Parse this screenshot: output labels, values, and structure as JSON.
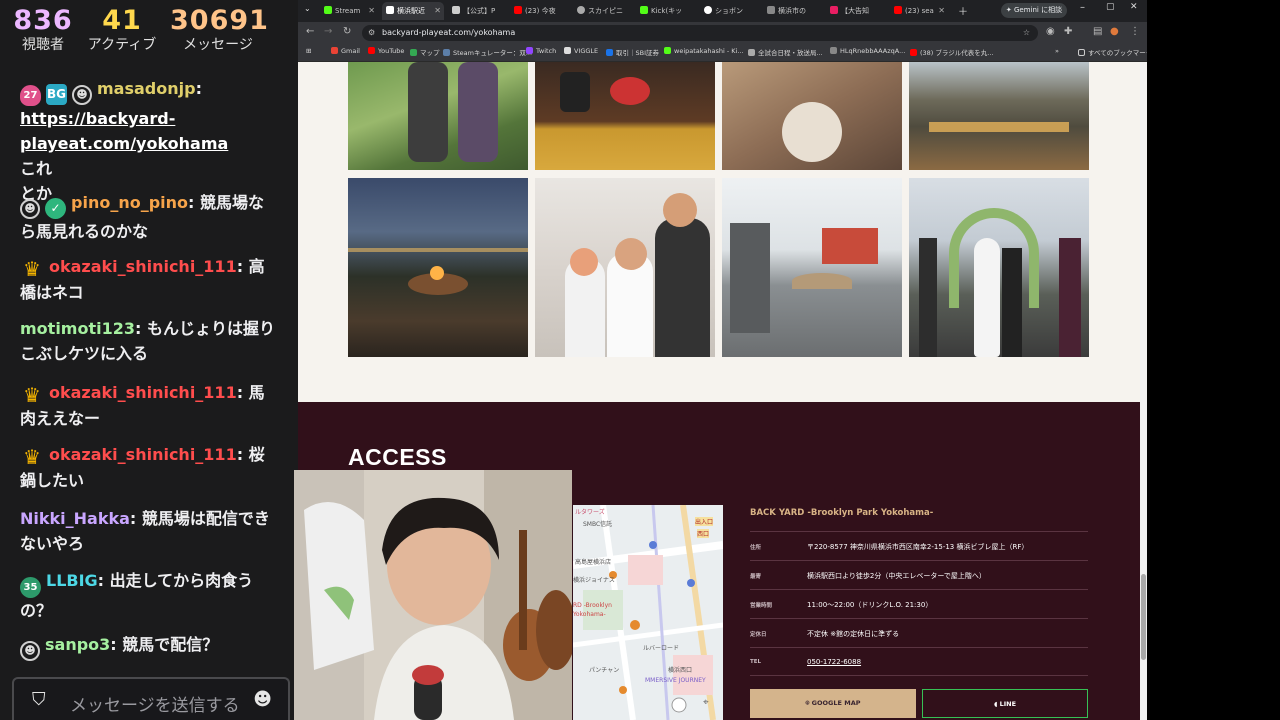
{
  "stats": {
    "viewers": {
      "value": "836",
      "label": "視聴者"
    },
    "active": {
      "value": "41",
      "label": "アクティブ"
    },
    "messages": {
      "value": "30691",
      "label": "メッセージ"
    }
  },
  "chat": [
    {
      "user": "masadonjp",
      "color": "#e0cf6a",
      "badges": [
        "pink-27",
        "bg",
        "dark"
      ],
      "lines": [
        "https://backyard-",
        "playeat.com/yokohama"
      ],
      "tail": "これ",
      "extra": "とか"
    },
    {
      "user": "pino_no_pino",
      "color": "#f7a44a",
      "badges": [
        "dark",
        "verified"
      ],
      "text": "競馬場なら馬見れるのかな"
    },
    {
      "user": "okazaki_shinichi_111",
      "color": "#ff4d4d",
      "badges": [
        "crown"
      ],
      "text": "高橋はネコ"
    },
    {
      "user": "motimoti123",
      "color": "#a6f0a0",
      "badges": [],
      "text": "もんじょりは握りこぶしケツに入る"
    },
    {
      "user": "okazaki_shinichi_111",
      "color": "#ff4d4d",
      "badges": [
        "crown"
      ],
      "text": "馬肉ええなー"
    },
    {
      "user": "okazaki_shinichi_111",
      "color": "#ff4d4d",
      "badges": [
        "crown"
      ],
      "text": "桜鍋したい"
    },
    {
      "user": "Nikki_Hakka",
      "color": "#c9a6ff",
      "badges": [],
      "text": "競馬場は配信できないやろ"
    },
    {
      "user": "LLBIG",
      "color": "#4dd8e6",
      "badges": [
        "teal-35"
      ],
      "text": "出走してから肉食うの？"
    },
    {
      "user": "sanpo3",
      "color": "#a6f0a0",
      "badges": [
        "dark"
      ],
      "text": "競馬で配信？"
    }
  ],
  "chat_input": {
    "placeholder": "メッセージを送信する"
  },
  "browser": {
    "tabs": [
      {
        "label": "Stream",
        "color": "#53fc18"
      },
      {
        "label": "横浜駅近",
        "color": "#fff",
        "active": true
      },
      {
        "label": "【公式】P",
        "color": "#ccc"
      },
      {
        "label": "(23) 今夜",
        "color": "#ff0000"
      },
      {
        "label": "スカイピニ",
        "color": "#aaa"
      },
      {
        "label": "Kick(キッ",
        "color": "#53fc18"
      },
      {
        "label": "ショボン",
        "color": "#fff"
      },
      {
        "label": "横浜市の",
        "color": "#888"
      },
      {
        "label": "【大告知",
        "color": "#e91e63"
      },
      {
        "label": "(23) sea",
        "color": "#ff0000"
      }
    ],
    "gemini": "Gemini に相談",
    "url": "backyard-playeat.com/yokohama",
    "bookmarks": [
      "Gmail",
      "YouTube",
      "マップ",
      "Steamキュレーター：双...",
      "Twitch",
      "VIGGLE",
      "取引｜SBI証券",
      "weipatakahashi - Ki...",
      "全試合日程・放送局...",
      "HLqRnebbAAAzqA...",
      "(38) ブラジル代表を丸...",
      "すべてのブックマーク"
    ]
  },
  "page": {
    "access_title": "ACCESS",
    "venue": "BACK YARD -Brooklyn Park Yokohama-",
    "info": [
      {
        "k": "住所",
        "v": "〒220-8577 神奈川県横浜市西区南幸2-15-13 横浜ビブレ屋上（RF）"
      },
      {
        "k": "最寄",
        "v": "横浜駅西口より徒歩2分（中央エレベーターで屋上階へ）"
      },
      {
        "k": "営業時間",
        "v": "11:00〜22:00（ドリンクL.O. 21:30）"
      },
      {
        "k": "定休日",
        "v": "不定休 ※館の定休日に準ずる"
      },
      {
        "k": "TEL",
        "v": "050-1722-6088"
      }
    ],
    "google_map": "GOOGLE MAP",
    "line": "LINE",
    "map_labels": [
      "ルタワーズ",
      "SMBC信託",
      "高島屋横浜店",
      "横浜ジョイナス",
      "RD -Brooklyn",
      "Yokohama-",
      "パンチャン",
      "MMERSIVE JOURNEY",
      "横浜西口",
      "出入口",
      "ルバーロード",
      "西口"
    ]
  }
}
